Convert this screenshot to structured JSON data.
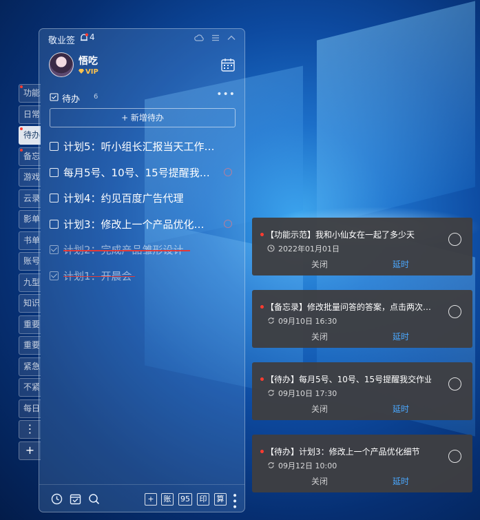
{
  "app": {
    "name": "敬业签",
    "bell_count": "4"
  },
  "user": {
    "name": "悟吃",
    "badge": "VIP"
  },
  "side_tabs": [
    {
      "label": "功能",
      "active": false,
      "dot": true
    },
    {
      "label": "日常",
      "active": false,
      "dot": false
    },
    {
      "label": "待办",
      "active": true,
      "dot": true
    },
    {
      "label": "备忘",
      "active": false,
      "dot": true
    },
    {
      "label": "游戏",
      "active": false,
      "dot": false
    },
    {
      "label": "云录",
      "active": false,
      "dot": false
    },
    {
      "label": "影单",
      "active": false,
      "dot": false
    },
    {
      "label": "书单",
      "active": false,
      "dot": false
    },
    {
      "label": "账号",
      "active": false,
      "dot": false
    },
    {
      "label": "九型",
      "active": false,
      "dot": false
    },
    {
      "label": "知识",
      "active": false,
      "dot": false
    },
    {
      "label": "重要",
      "active": false,
      "dot": false
    },
    {
      "label": "重要",
      "active": false,
      "dot": false
    },
    {
      "label": "紧急",
      "active": false,
      "dot": false
    },
    {
      "label": "不紧",
      "active": false,
      "dot": false
    },
    {
      "label": "每日",
      "active": false,
      "dot": false
    }
  ],
  "side_buttons": {
    "more": "⋮",
    "add": "+"
  },
  "section": {
    "title": "待办",
    "count": "6",
    "more": "•••",
    "add_label": "+ 新增待办"
  },
  "todos": [
    {
      "text": "计划5：听小组长汇报当天工作…",
      "done": false,
      "reminder": false
    },
    {
      "text": "每月5号、10号、15号提醒我…",
      "done": false,
      "reminder": true
    },
    {
      "text": "计划4：约见百度广告代理",
      "done": false,
      "reminder": false
    },
    {
      "text": "计划3：修改上一个产品优化…",
      "done": false,
      "reminder": true
    },
    {
      "text": "计划2：完成产品雏形设计",
      "done": true,
      "reminder": false
    },
    {
      "text": "计划1：开晨会",
      "done": true,
      "reminder": false
    }
  ],
  "bottombar": {
    "add": "+",
    "ledger": "账",
    "num": "95",
    "print": "印",
    "calc": "算"
  },
  "notifications": [
    {
      "title": "【功能示范】我和小仙女在一起了多少天",
      "time": "2022年01月01日",
      "repeat": false,
      "close": "关闭",
      "delay": "延时"
    },
    {
      "title": "【备忘录】修改批量问答的答案，点击两次…",
      "time": "09月10日  16:30",
      "repeat": true,
      "close": "关闭",
      "delay": "延时"
    },
    {
      "title": "【待办】每月5号、10号、15号提醒我交作业",
      "time": "09月10日  17:30",
      "repeat": true,
      "close": "关闭",
      "delay": "延时"
    },
    {
      "title": "【待办】计划3：修改上一个产品优化细节",
      "time": "09月12日  10:00",
      "repeat": true,
      "close": "关闭",
      "delay": "延时"
    }
  ],
  "colors": {
    "accent_delay": "#4aa8ff",
    "red_dot": "#ff3b30",
    "vip_gold": "#ffc34d"
  }
}
